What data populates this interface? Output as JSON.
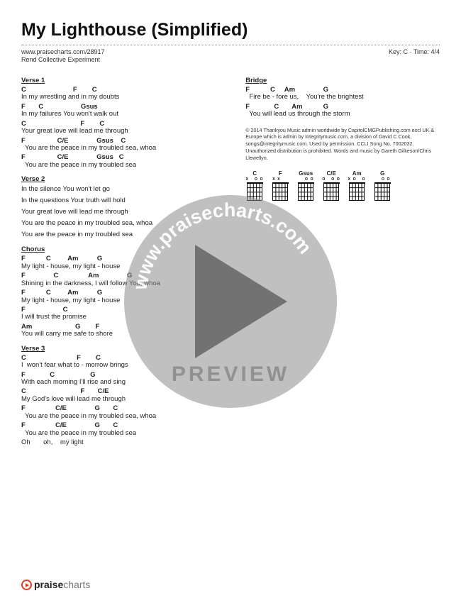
{
  "header": {
    "title": "My Lighthouse (Simplified)",
    "url": "www.praisecharts.com/28917",
    "artist": "Rend Collective Experiment",
    "key_time": "Key: C · Time: 4/4"
  },
  "left": {
    "v1": {
      "title": "Verse 1",
      "c1": "C                         F        C",
      "l1": "In my wrestling and in my doubts",
      "c2": "F       C                    Gsus",
      "l2": "In my failures You won't walk out",
      "c3": "C                             F        C",
      "l3": "Your great love will lead me through",
      "c4": "F                 C/E               Gsus    C",
      "l4": "  You are the peace in my troubled sea, whoa",
      "c5": "F                 C/E               Gsus   C",
      "l5": "  You are the peace in my troubled sea"
    },
    "v2": {
      "title": "Verse 2",
      "l1": "In the silence You won't let go",
      "l2": "In the questions Your truth will hold",
      "l3": "Your great love will lead me through",
      "l4": "You are the peace in my troubled sea, whoa",
      "l5": "You are the peace in my troubled sea"
    },
    "ch": {
      "title": "Chorus",
      "c1": "F           C         Am          G",
      "l1": "My light - house, my light - house",
      "c2": "F               C                Am               G",
      "l2": "Shining in the darkness, I will follow You, whoa",
      "c3": "F           C         Am          G",
      "l3": "My light - house, my light - house",
      "c4": "F                    C",
      "l4": "I will trust the promise",
      "c5": "Am                       G        F",
      "l5": "You will carry me safe to shore"
    },
    "v3": {
      "title": "Verse 3",
      "c1": "C                           F        C",
      "l1": "I  won't fear what to - morrow brings",
      "c2": "F             C                   G",
      "l2": "With each morning I'll rise and sing",
      "c3": "C                             F       C/E",
      "l3": "My God's love will lead me through",
      "c4": "F                C/E               G       C",
      "l4": "  You are the peace in my troubled sea, whoa",
      "c5": "F                C/E               G       C",
      "l5": "  You are the peace in my troubled sea",
      "l6": "Oh       oh,    my light"
    }
  },
  "right": {
    "bridge": {
      "title": "Bridge",
      "c1": "F           C     Am               G",
      "l1": "  Fire be - fore us,    You're the brightest",
      "c2": "F             C       Am           G",
      "l2": "  You will lead us through the storm"
    },
    "copyright": "© 2014 Thankyou Music admin worldwide by CapitolCMGPublishing.com excl UK & Europe which is admin by Integritymusic.com, a division of David C Cook, songs@integritymusic.com. Used by permission. CCLI Song No. 7002032. Unauthorized distribution is prohibited. Words and music by Gareth Gilkeson/Chris Llewellyn.",
    "chords": {
      "c": "C",
      "f": "F",
      "gsus": "Gsus",
      "ce": "C/E",
      "am": "Am",
      "g": "G",
      "m_c": "X   O O",
      "m_f": "X X    ",
      "m_gsus": "    O O",
      "m_ce": "O   O O",
      "m_am": "X O   O",
      "m_g": "    O O"
    }
  },
  "watermark": {
    "url": "www.praisecharts.com",
    "preview": "PREVIEW"
  },
  "footer": {
    "brand1": "praise",
    "brand2": "charts"
  }
}
